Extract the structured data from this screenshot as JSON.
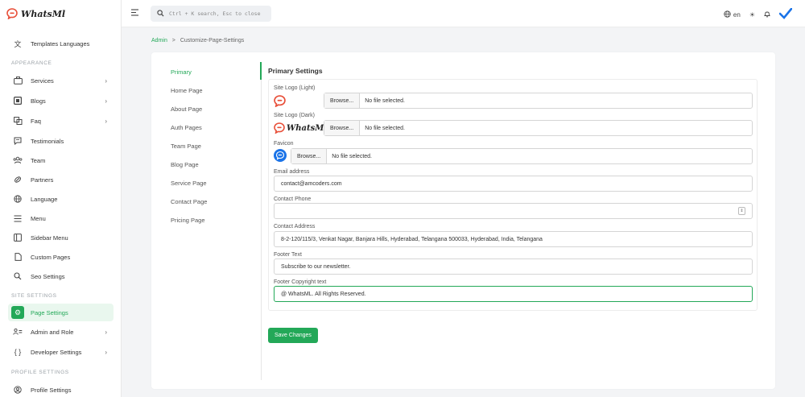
{
  "app": {
    "name": "WhatsMl"
  },
  "sidebar": {
    "top_item": "Templates Languages",
    "sections": {
      "appearance": "APPEARANCE",
      "site_settings": "SITE SETTINGS",
      "profile_settings": "PROFILE SETTINGS"
    },
    "items": {
      "services": "Services",
      "blogs": "Blogs",
      "faq": "Faq",
      "testimonials": "Testimonials",
      "team": "Team",
      "partners": "Partners",
      "language": "Language",
      "menu": "Menu",
      "sidebar_menu": "Sidebar Menu",
      "custom_pages": "Custom Pages",
      "seo_settings": "Seo Settings",
      "page_settings": "Page Settings",
      "admin_role": "Admin and Role",
      "developer_settings": "Developer Settings",
      "profile_settings": "Profile Settings"
    }
  },
  "topbar": {
    "search_placeholder": "Ctrl + K search, Esc to close",
    "language": "en"
  },
  "breadcrumb": {
    "home": "Admin",
    "separator": ">",
    "current": "Customize-Page-Settings"
  },
  "tabs": [
    "Primary",
    "Home Page",
    "About Page",
    "Auth Pages",
    "Team Page",
    "Blog Page",
    "Service Page",
    "Contact Page",
    "Pricing Page"
  ],
  "form": {
    "title": "Primary Settings",
    "site_logo_light": {
      "label": "Site Logo (Light)",
      "browse": "Browse...",
      "status": "No file selected."
    },
    "site_logo_dark": {
      "label": "Site Logo (Dark)",
      "browse": "Browse...",
      "status": "No file selected.",
      "logo_text": "WhatsMl"
    },
    "favicon": {
      "label": "Favicon",
      "browse": "Browse...",
      "status": "No file selected."
    },
    "email": {
      "label": "Email address",
      "value": "contact@amcoders.com"
    },
    "phone": {
      "label": "Contact Phone",
      "value": ""
    },
    "address": {
      "label": "Contact Address",
      "value": "8-2-120/115/3, Venkat Nagar, Banjara Hills, Hyderabad, Telangana 500033, Hyderabad, India, Telangana"
    },
    "footer_text": {
      "label": "Footer Text",
      "value": "Subscribe to our newsletter."
    },
    "footer_copyright": {
      "label": "Footer Copyright text",
      "value": "@ WhatsML. All Rights Reserved."
    },
    "save_label": "Save Changes"
  },
  "colors": {
    "accent": "#23a858",
    "brand_logo": "#e8503a",
    "favicon_blue": "#1a73e8"
  }
}
